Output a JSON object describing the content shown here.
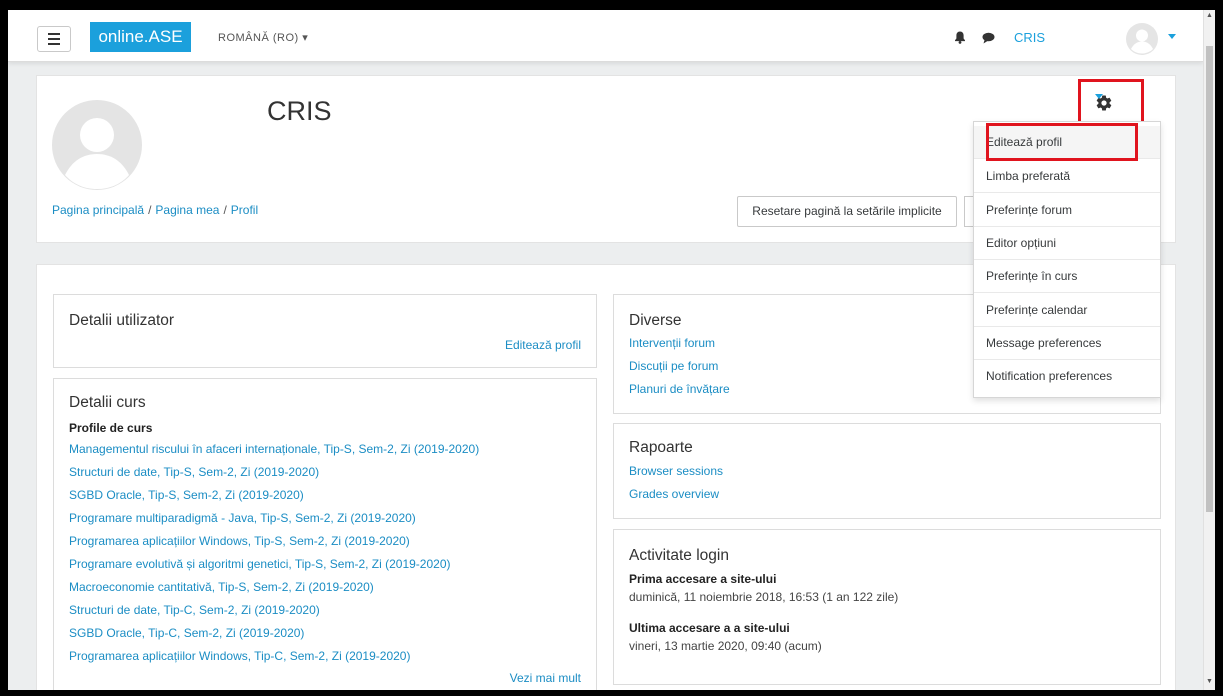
{
  "navbar": {
    "brand": "online.ASE",
    "language": "ROMÂNĂ (RO) ▾",
    "username": "CRIS"
  },
  "header": {
    "name": "CRIS",
    "breadcrumb": [
      "Pagina principală",
      "Pagina mea",
      "Profil"
    ],
    "reset_button": "Resetare pagină la setările implicite"
  },
  "settings_menu": {
    "items": [
      "Editează profil",
      "Limba preferată",
      "Preferințe forum",
      "Editor opțiuni",
      "Preferințe în curs",
      "Preferințe calendar",
      "Message preferences",
      "Notification preferences"
    ]
  },
  "user_details": {
    "title": "Detalii utilizator",
    "edit_link": "Editează profil"
  },
  "course_details": {
    "title": "Detalii curs",
    "subtitle": "Profile de curs",
    "courses": [
      "Managementul riscului în afaceri internaționale, Tip-S, Sem-2, Zi (2019-2020)",
      "Structuri de date, Tip-S, Sem-2, Zi (2019-2020)",
      "SGBD Oracle, Tip-S, Sem-2, Zi (2019-2020)",
      "Programare multiparadigmă - Java, Tip-S, Sem-2, Zi (2019-2020)",
      "Programarea aplicațiilor Windows, Tip-S, Sem-2, Zi (2019-2020)",
      "Programare evolutivă și algoritmi genetici, Tip-S, Sem-2, Zi (2019-2020)",
      "Macroeconomie cantitativă, Tip-S, Sem-2, Zi (2019-2020)",
      "Structuri de date, Tip-C, Sem-2, Zi (2019-2020)",
      "SGBD Oracle, Tip-C, Sem-2, Zi (2019-2020)",
      "Programarea aplicațiilor Windows, Tip-C, Sem-2, Zi (2019-2020)"
    ],
    "more_link": "Vezi mai mult"
  },
  "misc": {
    "title": "Diverse",
    "links": [
      "Intervenții forum",
      "Discuții pe forum",
      "Planuri de învățare"
    ]
  },
  "reports": {
    "title": "Rapoarte",
    "links": [
      "Browser sessions",
      "Grades overview"
    ]
  },
  "login_activity": {
    "title": "Activitate login",
    "first_label": "Prima accesare a site-ului",
    "first_value": "duminică, 11 noiembrie 2018, 16:53  (1 an 122 zile)",
    "last_label": "Ultima accesare a a site-ului",
    "last_value": "vineri, 13 martie 2020, 09:40  (acum)"
  },
  "colors": {
    "accent": "#1ba0dc",
    "link": "#1b8dc4",
    "highlight": "#e0141e"
  }
}
